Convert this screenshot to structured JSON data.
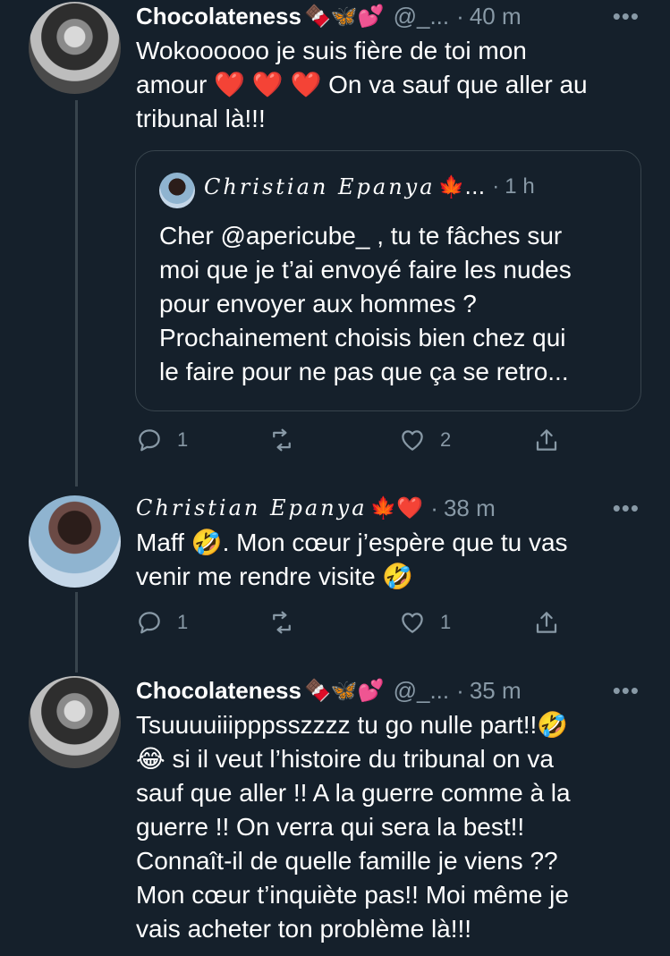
{
  "tweets": [
    {
      "name": "Chocolateness",
      "name_emoji": "🍫🦋💕",
      "handle": "@_...",
      "separator": "·",
      "time": "40 m",
      "text_lines": [
        "Wokoooooo je suis fière de toi mon",
        "amour",
        "On va sauf que aller au",
        "tribunal là!!!"
      ],
      "hearts": "❤️ ❤️ ❤️",
      "quote": {
        "name": "𝒞𝒽𝓇𝒾𝓈𝓉𝒾𝒶𝓃 𝐸𝓅𝒶𝓃𝓎𝒶",
        "name_plain": "Christian Epanya",
        "emoji": "🍁...",
        "separator": "·",
        "time": "1 h",
        "text": "Cher @apericube_  , tu te fâches sur\nmoi que je t’ai envoyé faire les nudes\npour envoyer aux hommes ?\nProchainement choisis bien  chez qui\nle faire pour ne pas que ça se retro..."
      },
      "replies": "1",
      "retweets": "",
      "likes": "2"
    },
    {
      "name_plain": "Christian Epanya",
      "name_emoji": "🍁❤️",
      "separator": "·",
      "time": "38 m",
      "text": "Maff 🤣. Mon cœur j’espère que tu vas\nvenir me rendre visite 🤣",
      "replies": "1",
      "retweets": "",
      "likes": "1"
    },
    {
      "name": "Chocolateness",
      "name_emoji": "🍫🦋💕",
      "handle": "@_...",
      "separator": "·",
      "time": "35 m",
      "text": "Tsuuuuiiipppsszzzz tu go nulle part!!🤣\n😂 si il veut l’histoire du tribunal on va\nsauf que aller !! A la guerre comme à la\nguerre !! On verra qui sera la best!!\nConnaît-il de quelle famille je viens ??\nMon cœur t’inquiète pas!! Moi même je\nvais acheter ton problème là!!!"
    }
  ],
  "more_label": "•••",
  "colors": {
    "background": "#15202b",
    "muted": "#8899a6",
    "border": "#38444d",
    "heart": "#e0245e"
  },
  "icons": [
    "reply-icon",
    "retweet-icon",
    "like-icon",
    "share-icon",
    "more-icon"
  ]
}
